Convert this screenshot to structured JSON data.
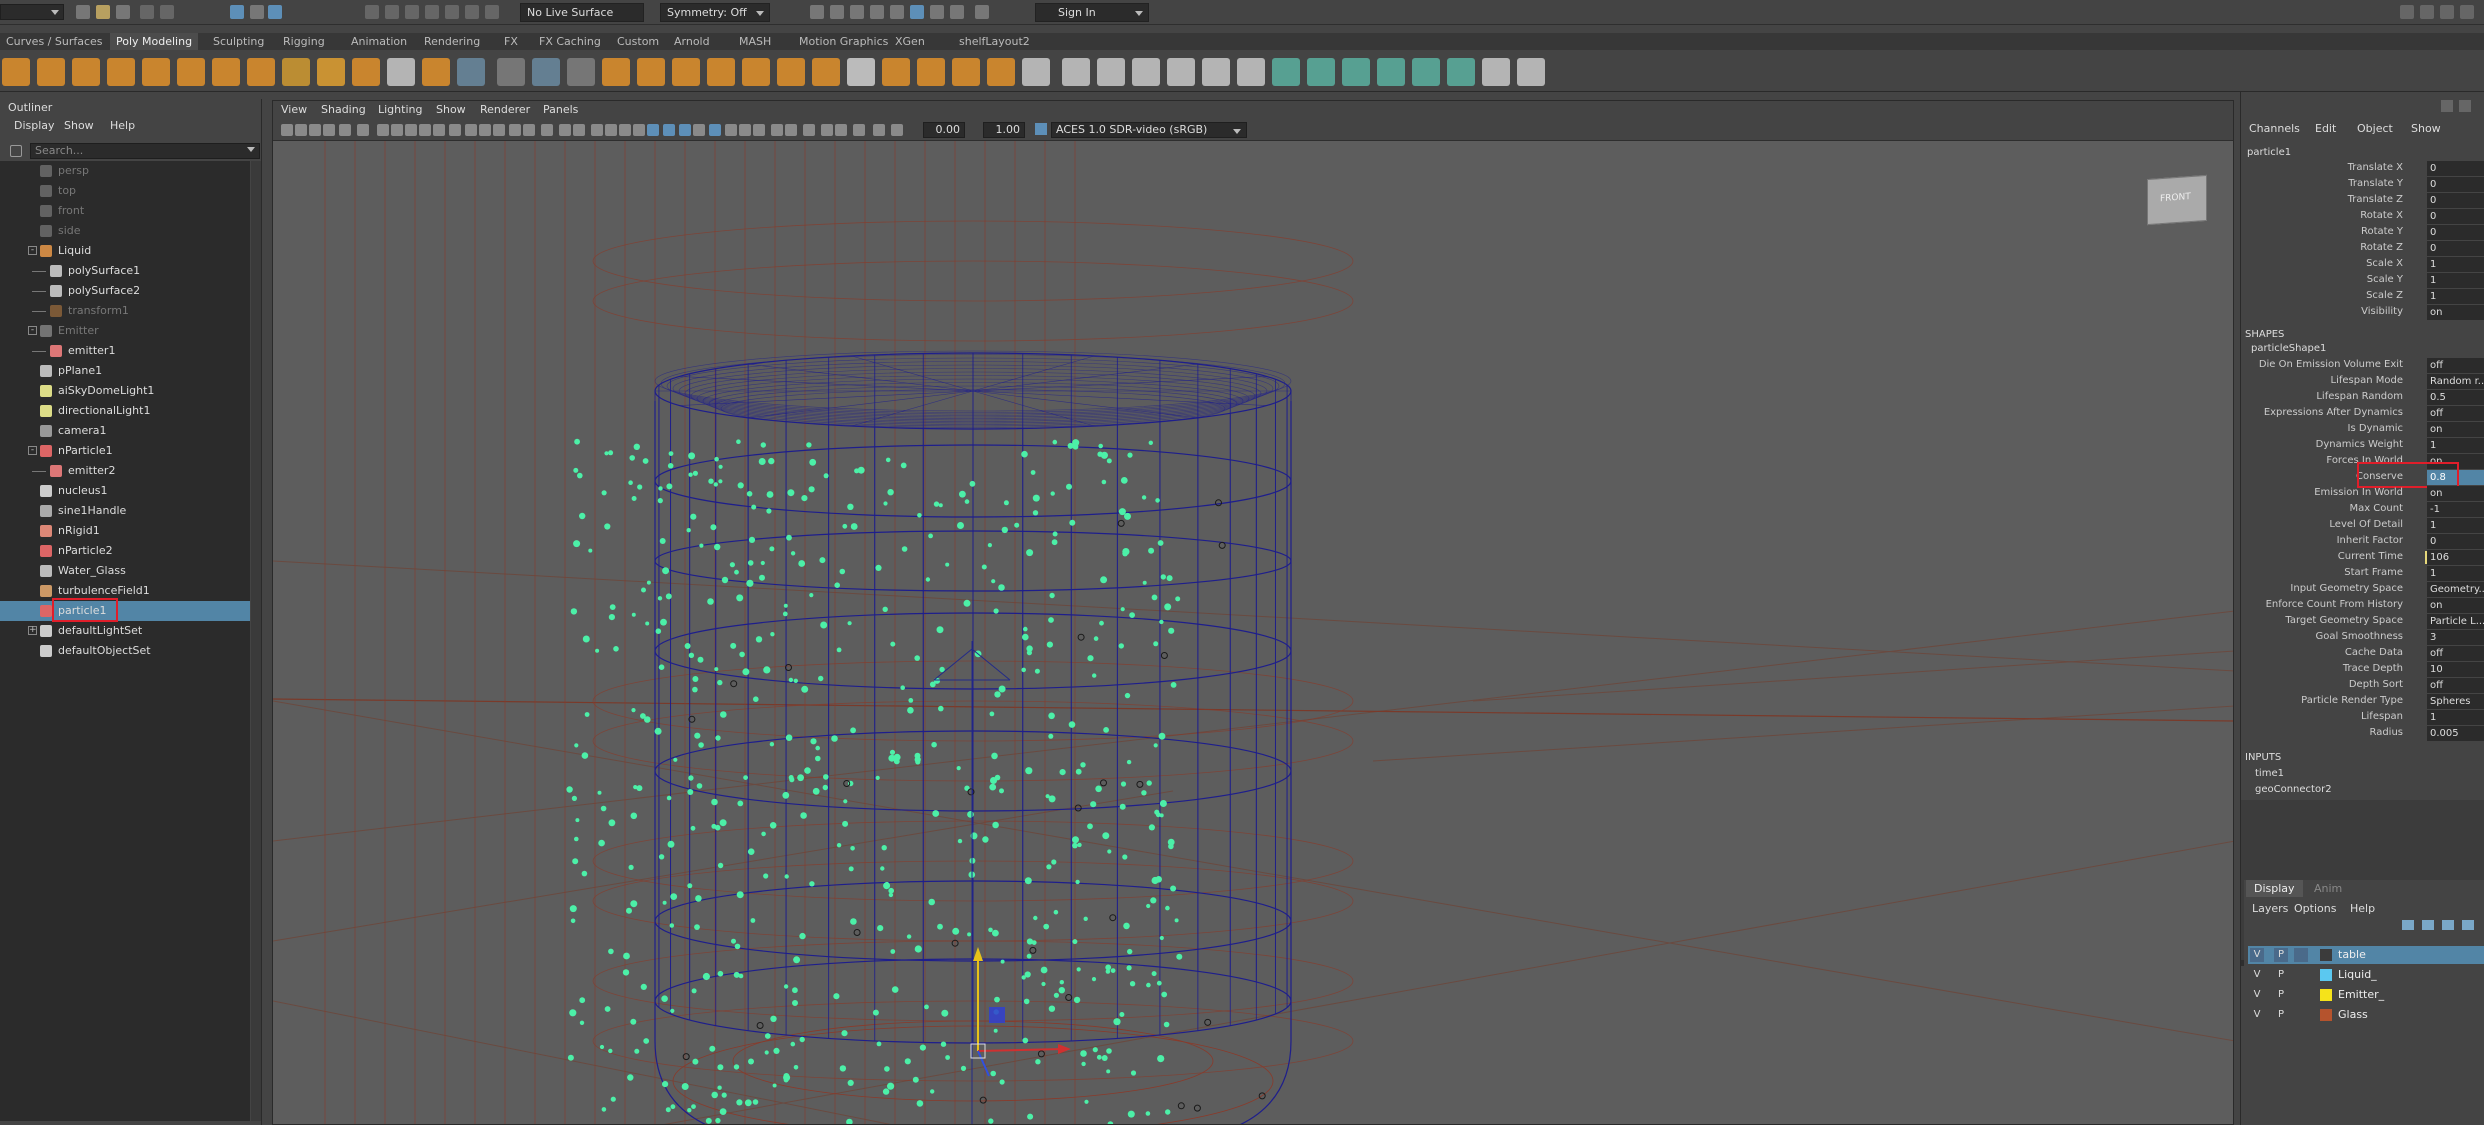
{
  "statusline": {
    "live_surface": "No Live Surface",
    "symmetry": "Symmetry: Off",
    "sign_in": "Sign In"
  },
  "shelf_tabs": [
    "Curves / Surfaces",
    "Poly Modeling",
    "Sculpting",
    "Rigging",
    "Animation",
    "Rendering",
    "FX",
    "FX Caching",
    "Custom",
    "Arnold",
    "MASH",
    "Motion Graphics",
    "XGen",
    "shelfLayout2"
  ],
  "active_shelf_tab": "Poly Modeling",
  "outliner": {
    "title": "Outliner",
    "menu": [
      "Display",
      "Show",
      "Help"
    ],
    "search_placeholder": "Search...",
    "items": [
      {
        "label": "persp",
        "dim": true,
        "icon": "camera-icon",
        "indent": 1
      },
      {
        "label": "top",
        "dim": true,
        "icon": "camera-icon",
        "indent": 1
      },
      {
        "label": "front",
        "dim": true,
        "icon": "camera-icon",
        "indent": 1
      },
      {
        "label": "side",
        "dim": true,
        "icon": "camera-icon",
        "indent": 1
      },
      {
        "label": "Liquid",
        "dim": false,
        "icon": "transform-icon",
        "indent": 1,
        "expand": "-"
      },
      {
        "label": "polySurface1",
        "dim": false,
        "icon": "mesh-icon",
        "indent": 2
      },
      {
        "label": "polySurface2",
        "dim": false,
        "icon": "mesh-icon",
        "indent": 2
      },
      {
        "label": "transform1",
        "dim": true,
        "icon": "transform-icon",
        "indent": 2
      },
      {
        "label": "Emitter",
        "dim": true,
        "icon": "mesh-icon",
        "indent": 1,
        "expand": "-"
      },
      {
        "label": "emitter1",
        "dim": false,
        "icon": "emitter-icon",
        "indent": 2
      },
      {
        "label": "pPlane1",
        "dim": false,
        "icon": "mesh-icon",
        "indent": 1
      },
      {
        "label": "aiSkyDomeLight1",
        "dim": false,
        "icon": "light-icon",
        "indent": 1
      },
      {
        "label": "directionalLight1",
        "dim": false,
        "icon": "light-icon",
        "indent": 1
      },
      {
        "label": "camera1",
        "dim": false,
        "icon": "camera-icon",
        "indent": 1
      },
      {
        "label": "nParticle1",
        "dim": false,
        "icon": "particle-icon",
        "indent": 1,
        "expand": "-"
      },
      {
        "label": "emitter2",
        "dim": false,
        "icon": "emitter-icon",
        "indent": 2
      },
      {
        "label": "nucleus1",
        "dim": false,
        "icon": "nucleus-icon",
        "indent": 1
      },
      {
        "label": "sine1Handle",
        "dim": false,
        "icon": "deformer-icon",
        "indent": 1
      },
      {
        "label": "nRigid1",
        "dim": false,
        "icon": "rigid-icon",
        "indent": 1
      },
      {
        "label": "nParticle2",
        "dim": false,
        "icon": "particle-icon",
        "indent": 1
      },
      {
        "label": "Water_Glass",
        "dim": false,
        "icon": "mesh-icon",
        "indent": 1
      },
      {
        "label": "turbulenceField1",
        "dim": false,
        "icon": "field-icon",
        "indent": 1
      },
      {
        "label": "particle1",
        "dim": false,
        "icon": "particle-icon",
        "indent": 1,
        "selected": true
      },
      {
        "label": "defaultLightSet",
        "dim": false,
        "icon": "set-icon",
        "indent": 1,
        "expand": "+"
      },
      {
        "label": "defaultObjectSet",
        "dim": false,
        "icon": "set-icon",
        "indent": 1
      }
    ]
  },
  "viewport": {
    "menu": [
      "View",
      "Shading",
      "Lighting",
      "Show",
      "Renderer",
      "Panels"
    ],
    "field1": "0.00",
    "field2": "1.00",
    "color_space": "ACES 1.0 SDR-video (sRGB)",
    "view_cube": "FRONT"
  },
  "channel_box": {
    "menu": [
      "Channels",
      "Edit",
      "Object",
      "Show"
    ],
    "object": "particle1",
    "transform": [
      {
        "name": "Translate X",
        "value": "0"
      },
      {
        "name": "Translate Y",
        "value": "0"
      },
      {
        "name": "Translate Z",
        "value": "0"
      },
      {
        "name": "Rotate X",
        "value": "0"
      },
      {
        "name": "Rotate Y",
        "value": "0"
      },
      {
        "name": "Rotate Z",
        "value": "0"
      },
      {
        "name": "Scale X",
        "value": "1"
      },
      {
        "name": "Scale Y",
        "value": "1"
      },
      {
        "name": "Scale Z",
        "value": "1"
      },
      {
        "name": "Visibility",
        "value": "on"
      }
    ],
    "shapes_label": "SHAPES",
    "shape_name": "particleShape1",
    "shape_attrs": [
      {
        "name": "Die On Emission Volume Exit",
        "value": "off"
      },
      {
        "name": "Lifespan Mode",
        "value": "Random r..."
      },
      {
        "name": "Lifespan Random",
        "value": "0.5"
      },
      {
        "name": "Expressions After Dynamics",
        "value": "off"
      },
      {
        "name": "Is Dynamic",
        "value": "on"
      },
      {
        "name": "Dynamics Weight",
        "value": "1"
      },
      {
        "name": "Forces In World",
        "value": "on"
      },
      {
        "name": "Conserve",
        "value": "0.8",
        "highlight": true
      },
      {
        "name": "Emission In World",
        "value": "on"
      },
      {
        "name": "Max Count",
        "value": "-1"
      },
      {
        "name": "Level Of Detail",
        "value": "1"
      },
      {
        "name": "Inherit Factor",
        "value": "0"
      },
      {
        "name": "Current Time",
        "value": "106",
        "key": true
      },
      {
        "name": "Start Frame",
        "value": "1"
      },
      {
        "name": "Input Geometry Space",
        "value": "Geometry..."
      },
      {
        "name": "Enforce Count From History",
        "value": "on"
      },
      {
        "name": "Target Geometry Space",
        "value": "Particle L..."
      },
      {
        "name": "Goal Smoothness",
        "value": "3"
      },
      {
        "name": "Cache Data",
        "value": "off"
      },
      {
        "name": "Trace Depth",
        "value": "10"
      },
      {
        "name": "Depth Sort",
        "value": "off"
      },
      {
        "name": "Particle Render Type",
        "value": "Spheres"
      },
      {
        "name": "Lifespan",
        "value": "1"
      },
      {
        "name": "Radius",
        "value": "0.005"
      }
    ],
    "inputs_label": "INPUTS",
    "inputs": [
      "time1",
      "geoConnector2"
    ]
  },
  "layer_editor": {
    "tabs": [
      "Display",
      "Anim"
    ],
    "menu": [
      "Layers",
      "Options",
      "Help"
    ],
    "layers": [
      {
        "v": "V",
        "p": "P",
        "name": "table",
        "color": "#3b3b3b",
        "selected": true
      },
      {
        "v": "V",
        "p": "P",
        "name": "Liquid_",
        "color": "#5bc8f0"
      },
      {
        "v": "V",
        "p": "P",
        "name": "Emitter_",
        "color": "#f5e31a"
      },
      {
        "v": "V",
        "p": "P",
        "name": "Glass",
        "color": "#b5532d"
      }
    ]
  },
  "colors": {
    "selection": "#5285a6",
    "particle": "#4cf0a8",
    "wire_blue": "#1e1e8c",
    "wire_red": "#8a3a2a",
    "highlight_box": "#e01e2a"
  }
}
